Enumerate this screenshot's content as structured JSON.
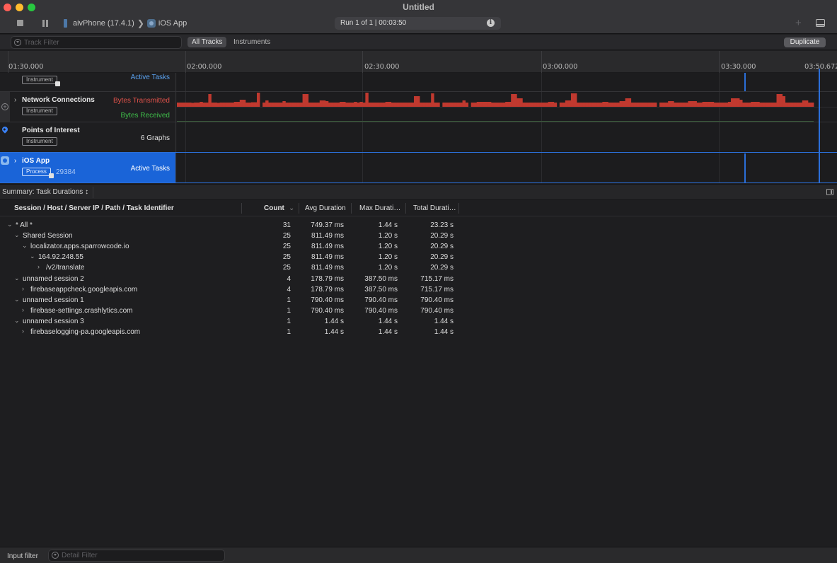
{
  "window": {
    "title": "Untitled",
    "breadcrumb_device": "aivPhone (17.4.1)",
    "breadcrumb_separator": "❯",
    "breadcrumb_app": "iOS App",
    "run_info": "Run 1 of 1  |  00:03:50",
    "add_button": "+"
  },
  "filterbar": {
    "track_filter_placeholder": "Track Filter",
    "all_tracks": "All Tracks",
    "instruments": "Instruments",
    "duplicate": "Duplicate"
  },
  "ruler": {
    "ticks": [
      "01:30.000",
      "02:00.000",
      "02:30.000",
      "03:00.000",
      "03:30.000"
    ],
    "current_time": "03:50.672"
  },
  "tracks": [
    {
      "name": "",
      "badge": "Instrument",
      "right_label": "Active Tasks",
      "right_color": "#5aa2f0"
    },
    {
      "name": "Network Connections",
      "badge": "Instrument",
      "labels": [
        {
          "text": "Bytes Transmitted",
          "color": "#e0524a"
        },
        {
          "text": "Bytes Received",
          "color": "#3fbf4a"
        }
      ]
    },
    {
      "name": "Points of Interest",
      "badge": "Instrument",
      "right_label": "6 Graphs"
    },
    {
      "name": "iOS App",
      "badge": "Process",
      "pid": "29384",
      "right_label": "Active Tasks"
    }
  ],
  "bytes_transmitted_levels": [
    0.3,
    0.3,
    0.3,
    0.3,
    0.3,
    0.28,
    0.3,
    0.3,
    0.35,
    0.3,
    0.3,
    0.9,
    0.3,
    0.3,
    0.28,
    0.3,
    0.3,
    0.3,
    0.3,
    0.3,
    0.35,
    0.35,
    0.5,
    0.5,
    0.3,
    0.3,
    0.32,
    0.32,
    1.0,
    0,
    0.3,
    0.45,
    0.3,
    0.3,
    0.3,
    0.3,
    0.3,
    0.4,
    0.3,
    0.3,
    0.3,
    0.3,
    0.3,
    0.3,
    0.9,
    0.9,
    0.3,
    0.3,
    0.3,
    0.3,
    0.45,
    0.45,
    0.4,
    0.3,
    0.3,
    0.3,
    0.3,
    0.35,
    0.35,
    0.3,
    0.3,
    0.3,
    0.35,
    0.3,
    0.35,
    0.3,
    1.0,
    0.3,
    0.3,
    0.3,
    0.3,
    0.3,
    0.3,
    0.35,
    0.35,
    0.3,
    0.3,
    0.3,
    0.3,
    0.3,
    0.3,
    0.3,
    0.3,
    0.75,
    0.75,
    0.3,
    0.3,
    0.3,
    0.3,
    0.95,
    0.3,
    0.3,
    0,
    0.3,
    0.3,
    0.3,
    0.3,
    0.3,
    0.3,
    0.3,
    0.45,
    0.3,
    0,
    0.3,
    0.3,
    0.35,
    0.35,
    0.35,
    0.35,
    0.35,
    0.3,
    0.3,
    0.3,
    0.3,
    0.3,
    0.35,
    0.35,
    0.9,
    0.9,
    0.6,
    0.6,
    0.3,
    0.3,
    0.3,
    0.3,
    0.3,
    0.3,
    0.3,
    0.3,
    0.3,
    0.35,
    0.35,
    0.3,
    0,
    0.3,
    0.3,
    0.45,
    0.45,
    0.95,
    0.95,
    0.3,
    0.3,
    0.3,
    0.3,
    0.3,
    0.3,
    0.3,
    0.3,
    0.3,
    0.35,
    0.35,
    0.3,
    0.3,
    0.3,
    0.3,
    0.4,
    0.4,
    0.6,
    0.6,
    0.3,
    0.3,
    0.3,
    0.3,
    0.3,
    0.3,
    0.3,
    0.3,
    0.3,
    0,
    0.3,
    0.3,
    0.3,
    0.4,
    0.4,
    0.3,
    0.3,
    0.3,
    0.3,
    0.3,
    0.4,
    0.4,
    0.4,
    0.3,
    0.3,
    0.35,
    0.35,
    0.35,
    0.35,
    0.3,
    0.3,
    0.3,
    0.3,
    0.3,
    0.35,
    0.6,
    0.6,
    0.6,
    0.5,
    0.3,
    0.3,
    0.3,
    0.35,
    0.35,
    0.35,
    0.3,
    0.3,
    0.3,
    0.3,
    0.3,
    0.3,
    0.9,
    0.9,
    0.75,
    0.3,
    0.3,
    0.3,
    0.3,
    0.3,
    0.3,
    0.45,
    0.45,
    0.3,
    0.3
  ],
  "summary": {
    "selector": "Summary: Task Durations ↕"
  },
  "table": {
    "columns": [
      "Session / Host / Server IP / Path / Task Identifier",
      "Count",
      "Avg Duration",
      "Max Durati…",
      "Total Durati…"
    ],
    "rows": [
      {
        "name": "* All *",
        "level": 0,
        "expanded": true,
        "count": "31",
        "avg": "749.37 ms",
        "max": "1.44 s",
        "total": "23.23 s"
      },
      {
        "name": "Shared Session",
        "level": 1,
        "expanded": true,
        "count": "25",
        "avg": "811.49 ms",
        "max": "1.20 s",
        "total": "20.29 s"
      },
      {
        "name": "localizator.apps.sparrowcode.io",
        "level": 2,
        "expanded": true,
        "count": "25",
        "avg": "811.49 ms",
        "max": "1.20 s",
        "total": "20.29 s"
      },
      {
        "name": "164.92.248.55",
        "level": 3,
        "expanded": true,
        "count": "25",
        "avg": "811.49 ms",
        "max": "1.20 s",
        "total": "20.29 s"
      },
      {
        "name": "/v2/translate",
        "level": 4,
        "expanded": false,
        "count": "25",
        "avg": "811.49 ms",
        "max": "1.20 s",
        "total": "20.29 s"
      },
      {
        "name": "unnamed session 2",
        "level": 1,
        "expanded": true,
        "count": "4",
        "avg": "178.79 ms",
        "max": "387.50 ms",
        "total": "715.17 ms"
      },
      {
        "name": "firebaseappcheck.googleapis.com",
        "level": 2,
        "expanded": false,
        "count": "4",
        "avg": "178.79 ms",
        "max": "387.50 ms",
        "total": "715.17 ms"
      },
      {
        "name": "unnamed session 1",
        "level": 1,
        "expanded": true,
        "count": "1",
        "avg": "790.40 ms",
        "max": "790.40 ms",
        "total": "790.40 ms"
      },
      {
        "name": "firebase-settings.crashlytics.com",
        "level": 2,
        "expanded": false,
        "count": "1",
        "avg": "790.40 ms",
        "max": "790.40 ms",
        "total": "790.40 ms"
      },
      {
        "name": "unnamed session 3",
        "level": 1,
        "expanded": true,
        "count": "1",
        "avg": "1.44 s",
        "max": "1.44 s",
        "total": "1.44 s"
      },
      {
        "name": "firebaselogging-pa.googleapis.com",
        "level": 2,
        "expanded": false,
        "count": "1",
        "avg": "1.44 s",
        "max": "1.44 s",
        "total": "1.44 s"
      }
    ]
  },
  "bottom": {
    "input_filter_label": "Input filter",
    "detail_filter_placeholder": "Detail Filter"
  },
  "icons": {
    "info": "i",
    "chevron_right": "›",
    "chevron_down": "⌄",
    "sort_down": "⌄",
    "plus_circle": "+"
  }
}
